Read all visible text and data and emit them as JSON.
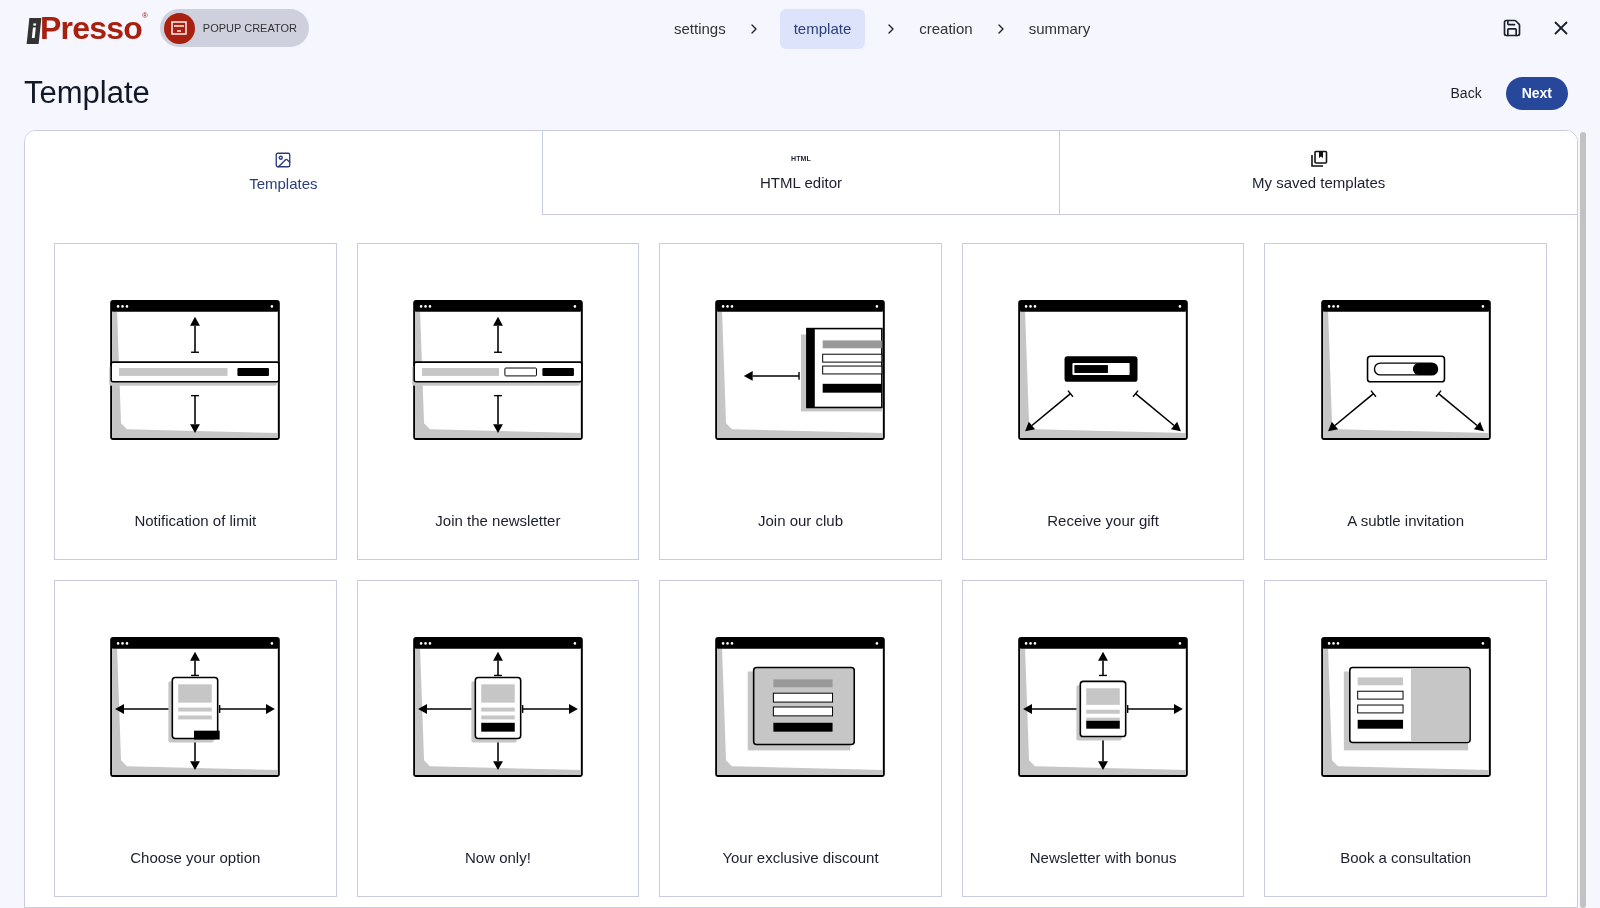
{
  "app": {
    "logo_mark": "i",
    "logo": "Presso",
    "registered": "®",
    "module": "POPUP CREATOR"
  },
  "steps": [
    {
      "label": "settings",
      "selected": false
    },
    {
      "label": "template",
      "selected": true
    },
    {
      "label": "creation",
      "selected": false
    },
    {
      "label": "summary",
      "selected": false
    }
  ],
  "title": "Template",
  "actions": {
    "back": "Back",
    "next": "Next"
  },
  "tabs": [
    {
      "label": "Templates",
      "kind": "image",
      "selected": true
    },
    {
      "label": "HTML editor",
      "kind": "html",
      "icon_text": "HTML",
      "selected": false
    },
    {
      "label": "My saved templates",
      "kind": "saved",
      "selected": false
    }
  ],
  "templates": [
    {
      "label": "Notification of limit",
      "kind": "bar"
    },
    {
      "label": "Join the newsletter",
      "kind": "bar-input"
    },
    {
      "label": "Join our club",
      "kind": "side"
    },
    {
      "label": "Receive your gift",
      "kind": "gift"
    },
    {
      "label": "A subtle invitation",
      "kind": "toggle"
    },
    {
      "label": "Choose your option",
      "kind": "options"
    },
    {
      "label": "Now only!",
      "kind": "center"
    },
    {
      "label": "Your exclusive discount",
      "kind": "discount"
    },
    {
      "label": "Newsletter with bonus",
      "kind": "bonus"
    },
    {
      "label": "Book a consultation",
      "kind": "consult"
    }
  ]
}
